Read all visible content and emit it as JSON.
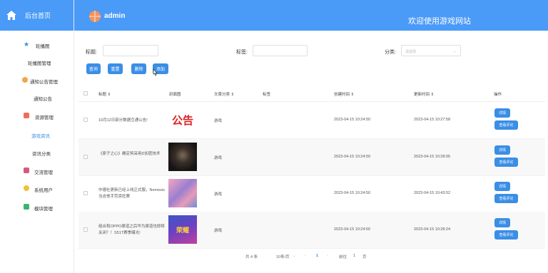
{
  "sidebar": {
    "home": "后台首页",
    "items": [
      {
        "label": "轮播图",
        "icon": "star-icon",
        "color": "#3a8ee6",
        "sub": false
      },
      {
        "label": "轮播图管理",
        "sub": true
      },
      {
        "label": "通知公告管理",
        "icon": "gear-icon",
        "color": "#f2a54c",
        "sub": false
      },
      {
        "label": "通知公告",
        "sub": true
      },
      {
        "label": "资源管理",
        "icon": "grid-icon",
        "color": "#ef6e5a",
        "sub": false
      },
      {
        "label": "游戏资讯",
        "sub": true,
        "active": true
      },
      {
        "label": "资讯分类",
        "sub": true
      },
      {
        "label": "交流管理",
        "icon": "chat-icon",
        "color": "#d45b7c",
        "sub": false
      },
      {
        "label": "系统用户",
        "icon": "user-icon",
        "color": "#f2c038",
        "sub": false
      },
      {
        "label": "模块管理",
        "icon": "module-icon",
        "color": "#3cb371",
        "sub": false
      }
    ]
  },
  "header": {
    "user": "admin",
    "welcome": "欢迎使用游戏网站"
  },
  "filters": {
    "title_label": "标题:",
    "tag_label": "标签:",
    "category_label": "分类:",
    "category_placeholder": "请选择"
  },
  "buttons": {
    "query": "查询",
    "reset": "重置",
    "delete": "删除",
    "add": "添加"
  },
  "table": {
    "headers": [
      "标题 ⇕",
      "封面图",
      "文章分类 ⇕",
      "标签",
      "创建时间 ⇕",
      "更新时间 ⇕",
      "操作"
    ],
    "rows": [
      {
        "title": "10月12日部分数据互通公告!",
        "category": "游戏",
        "tag": "",
        "created": "2023-04-15 10:24:50",
        "updated": "2023-04-15 10:27:58",
        "cover": "公告"
      },
      {
        "title": "《原子之心》确定将采用D加密技术",
        "category": "游戏",
        "tag": "",
        "created": "2023-04-15 10:24:50",
        "updated": "2023-04-15 10:28:05",
        "cover": ""
      },
      {
        "title": "中德社更新已经上线正式服，Nemesis当吉他手劳资狂赛",
        "category": "游戏",
        "tag": "",
        "created": "2023-04-15 10:24:50",
        "updated": "2023-04-15 10:43:52",
        "cover": ""
      },
      {
        "title": "组合和OPPO渠道之后华为渠道也即将关闭？！S51T赛季曝光!",
        "category": "游戏",
        "tag": "",
        "created": "2023-04-15 10:24:50",
        "updated": "2023-04-15 10:28:24",
        "cover": "荣耀"
      }
    ],
    "detail": "详情",
    "comments": "查看评论"
  },
  "pagination": {
    "total": "共 4 条",
    "per_page": "10条/页",
    "prev": "‹",
    "current": "1",
    "next": "›",
    "goto": "前往",
    "page": "1",
    "unit": "页"
  }
}
